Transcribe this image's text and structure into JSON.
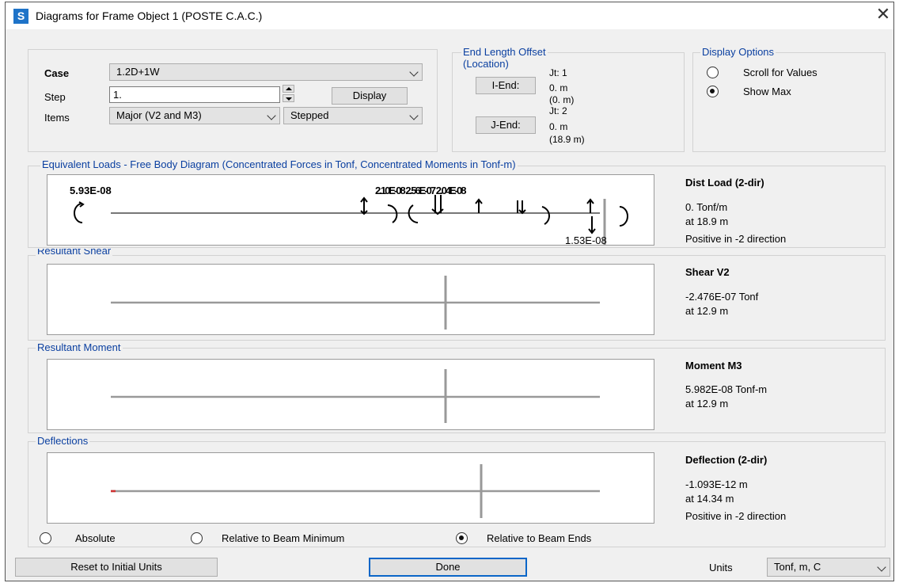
{
  "window": {
    "title": "Diagrams for Frame Object 1  (POSTE C.A.C.)",
    "logo_letter": "S",
    "close_glyph": "✕"
  },
  "case": {
    "label": "Case",
    "value": "1.2D+1W"
  },
  "step": {
    "label": "Step",
    "value": "1."
  },
  "display_button": "Display",
  "items": {
    "label": "Items",
    "value": "Major (V2 and M3)",
    "style_value": "Stepped"
  },
  "end_offset": {
    "title": "End Length Offset",
    "subtitle": "(Location)",
    "i_end_button": "I-End:",
    "j_end_button": "J-End:",
    "i_jt": "Jt:  1",
    "i_len": "0. m",
    "i_loc": "(0. m)",
    "j_jt": "Jt:  2",
    "j_len": "0. m",
    "j_loc": "(18.9 m)"
  },
  "display_options": {
    "title": "Display Options",
    "scroll": "Scroll for Values",
    "show_max": "Show Max",
    "selected": "show_max"
  },
  "fbd": {
    "title": "Equivalent Loads - Free Body Diagram  (Concentrated Forces in Tonf, Concentrated Moments in Tonf-m)",
    "left_label": "5.93E-08",
    "overlap_label": "2.10E-08 2.56E-07 2.04E-08",
    "bottom_label": "1.53E-08",
    "side_title": "Dist Load (2-dir)",
    "side_value": "0. Tonf/m",
    "side_at": "at 18.9 m",
    "side_note": "Positive in -2 direction"
  },
  "shear": {
    "title": "Resultant Shear",
    "side_title": "Shear V2",
    "side_value": "-2.476E-07 Tonf",
    "side_at": "at 12.9 m"
  },
  "moment": {
    "title": "Resultant Moment",
    "side_title": "Moment M3",
    "side_value": "5.982E-08 Tonf-m",
    "side_at": "at 12.9 m"
  },
  "deflection": {
    "title": "Deflections",
    "side_title": "Deflection (2-dir)",
    "side_value": "-1.093E-12 m",
    "side_at": "at 14.34 m",
    "side_note": "Positive in -2 direction",
    "opt_absolute": "Absolute",
    "opt_rel_min": "Relative to Beam Minimum",
    "opt_rel_ends": "Relative to Beam Ends",
    "selected": "rel_ends"
  },
  "footer": {
    "reset": "Reset to Initial Units",
    "done": "Done",
    "units_label": "Units",
    "units_value": "Tonf, m, C"
  }
}
